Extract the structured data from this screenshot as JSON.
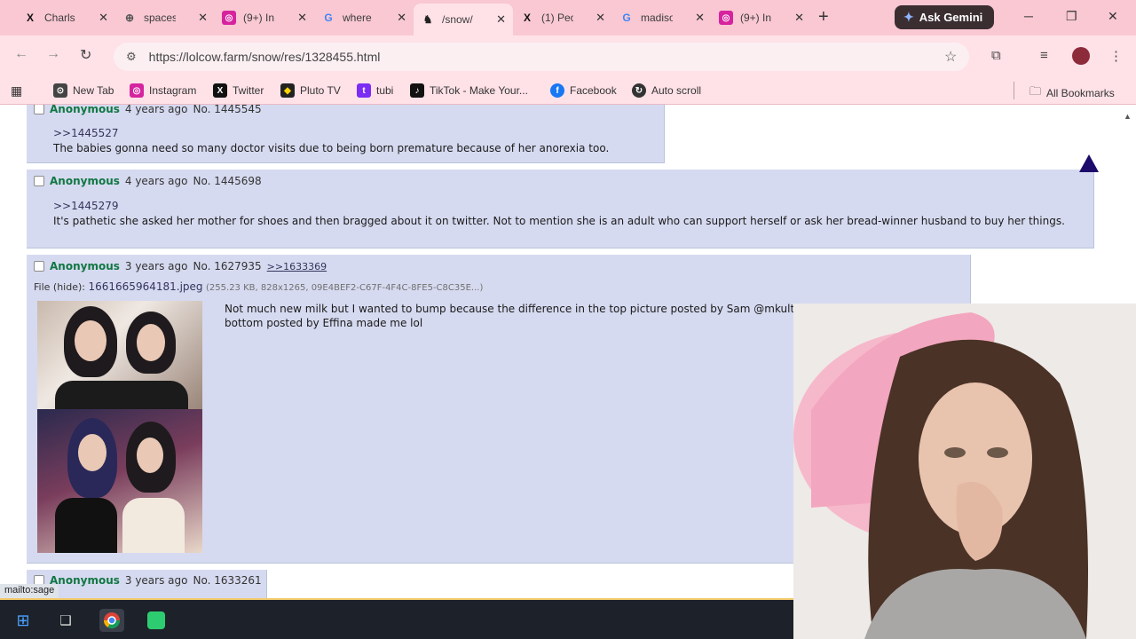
{
  "tabs": [
    {
      "title": "Charls",
      "icon": "x-icon",
      "active": false
    },
    {
      "title": "spaces",
      "icon": "globe-icon",
      "active": false
    },
    {
      "title": "(9+) In",
      "icon": "instagram-icon",
      "active": false
    },
    {
      "title": "where",
      "icon": "google-icon",
      "active": false
    },
    {
      "title": "/snow/",
      "icon": "lolcow-icon",
      "active": true
    },
    {
      "title": "(1) Peo",
      "icon": "x-icon",
      "active": false
    },
    {
      "title": "madiso",
      "icon": "google-icon",
      "active": false
    },
    {
      "title": "(9+) In",
      "icon": "instagram-icon",
      "active": false
    }
  ],
  "gemini_label": "Ask Gemini",
  "url": "https://lolcow.farm/snow/res/1328455.html",
  "bookmarks": [
    {
      "label": "New Tab",
      "color": "#444444",
      "glyph": "⊙"
    },
    {
      "label": "Instagram",
      "color": "#d6249f",
      "glyph": "◎"
    },
    {
      "label": "Twitter",
      "color": "#111111",
      "glyph": "X"
    },
    {
      "label": "Pluto TV",
      "color": "#222222",
      "glyph": "◆"
    },
    {
      "label": "tubi",
      "color": "#7b2cf5",
      "glyph": "t"
    },
    {
      "label": "TikTok - Make Your...",
      "color": "#111111",
      "glyph": "♪"
    },
    {
      "label": "Facebook",
      "color": "#1877f2",
      "glyph": "f"
    },
    {
      "label": "Auto scroll",
      "color": "#333333",
      "glyph": "↻"
    }
  ],
  "all_bookmarks": "All Bookmarks",
  "posts": [
    {
      "name": "Anonymous",
      "age": "4 years ago",
      "no": "No. 1445545",
      "quote": ">>1445527",
      "body": "The babies gonna need so many doctor visits due to being born premature because of her anorexia too."
    },
    {
      "name": "Anonymous",
      "age": "4 years ago",
      "no": "No. 1445698",
      "quote": ">>1445279",
      "body": "It's pathetic she asked her mother for shoes and then bragged about it on twitter. Not to mention she is an adult who can support herself or ask her bread-winner husband to buy her things."
    },
    {
      "name": "Anonymous",
      "age": "3 years ago",
      "no": "No. 1627935",
      "backlink": ">>1633369",
      "file_label": "File",
      "file_hide": "(hide):",
      "file_name": "1661665964181.jpeg",
      "file_meta": "(255.23 KB, 828x1265, 09E4BEF2-C67F-4F4C-8FE5-C8C35E...)",
      "body_line1": "Not much new milk but I wanted to bump because the difference in the top picture posted by Sam @mkultragoth and the",
      "body_line2": "bottom posted by Effina made me lol"
    },
    {
      "name": "Anonymous",
      "age": "3 years ago",
      "no": "No. 1633261"
    }
  ],
  "status_text": "mailto:sage"
}
